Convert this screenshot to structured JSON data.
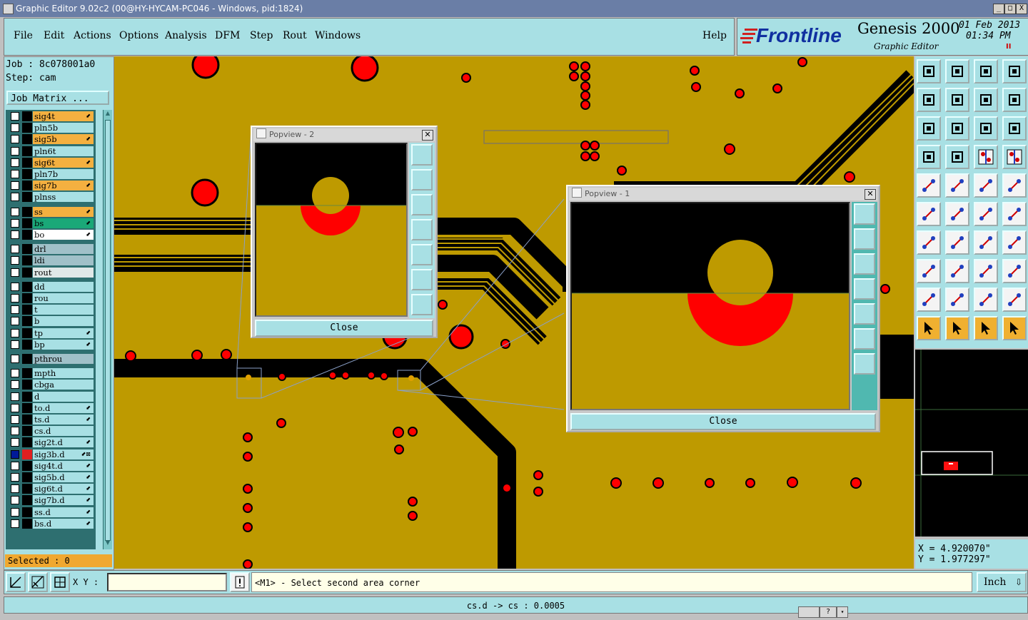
{
  "window": {
    "title": "Graphic Editor 9.02c2 (00@HY-HYCAM-PC046 - Windows, pid:1824)",
    "minimize": "_",
    "maximize": "□",
    "close": "X"
  },
  "menu": [
    "File",
    "Edit",
    "Actions",
    "Options",
    "Analysis",
    "DFM",
    "Step",
    "Rout",
    "Windows"
  ],
  "help": "Help",
  "brand": {
    "logo": "Frontline",
    "product": "Genesis 2000",
    "subtitle": "Graphic Editor",
    "date": "01 Feb 2013",
    "time": "01:34 PM",
    "pause": "II"
  },
  "job": {
    "job_label": "Job : 8c078001a0",
    "step_label": "Step: cam",
    "matrix_button": "Job Matrix ..."
  },
  "layers": [
    {
      "name": "sig4t",
      "color": "#f4b040",
      "arrow": "⬋",
      "sel": false
    },
    {
      "name": "pln5b",
      "color": "#a8e0e4",
      "arrow": "",
      "sel": false
    },
    {
      "name": "sig5b",
      "color": "#f4b040",
      "arrow": "⬋",
      "sel": false
    },
    {
      "name": "pln6t",
      "color": "#a8e0e4",
      "arrow": "",
      "sel": false
    },
    {
      "name": "sig6t",
      "color": "#f4b040",
      "arrow": "⬋",
      "sel": false
    },
    {
      "name": "pln7b",
      "color": "#a8e0e4",
      "arrow": "",
      "sel": false
    },
    {
      "name": "sig7b",
      "color": "#f4b040",
      "arrow": "⬋",
      "sel": false
    },
    {
      "name": "plnss",
      "color": "#a8e0e4",
      "arrow": "",
      "sel": false
    },
    {
      "name": "ss",
      "color": "#f4b040",
      "arrow": "⬋",
      "sel": false
    },
    {
      "name": "bs",
      "color": "#1aa878",
      "arrow": "⬋",
      "sel": false
    },
    {
      "name": "bo",
      "color": "#ffffff",
      "arrow": "⬋",
      "sel": false
    },
    {
      "name": "drl",
      "color": "#a0c0c8",
      "arrow": "",
      "sel": false
    },
    {
      "name": "ldi",
      "color": "#a0c0c8",
      "arrow": "",
      "sel": false
    },
    {
      "name": "rout",
      "color": "#e0e8e8",
      "arrow": "",
      "sel": false
    },
    {
      "name": "dd",
      "color": "#a8e0e4",
      "arrow": "",
      "sel": false
    },
    {
      "name": "rou",
      "color": "#a8e0e4",
      "arrow": "",
      "sel": false
    },
    {
      "name": "t",
      "color": "#a8e0e4",
      "arrow": "",
      "sel": false
    },
    {
      "name": "b",
      "color": "#a8e0e4",
      "arrow": "",
      "sel": false
    },
    {
      "name": "tp",
      "color": "#a8e0e4",
      "arrow": "⬋",
      "sel": false
    },
    {
      "name": "bp",
      "color": "#a8e0e4",
      "arrow": "⬋",
      "sel": false
    },
    {
      "name": "pthrou",
      "color": "#a0c0c8",
      "arrow": "",
      "sel": false
    },
    {
      "name": "mpth",
      "color": "#a8e0e4",
      "arrow": "",
      "sel": false
    },
    {
      "name": "cbga",
      "color": "#a8e0e4",
      "arrow": "",
      "sel": false
    },
    {
      "name": "d",
      "color": "#a8e0e4",
      "arrow": "",
      "sel": false
    },
    {
      "name": "to.d",
      "color": "#a8e0e4",
      "arrow": "⬋",
      "sel": false
    },
    {
      "name": "ts.d",
      "color": "#a8e0e4",
      "arrow": "⬋",
      "sel": false
    },
    {
      "name": "cs.d",
      "color": "#a8e0e4",
      "arrow": "",
      "sel": false
    },
    {
      "name": "sig2t.d",
      "color": "#a8e0e4",
      "arrow": "⬋",
      "sel": false
    },
    {
      "name": "sig3b.d",
      "color": "#a8e0e4",
      "arrow": "⬋⊠",
      "sel": true
    },
    {
      "name": "sig4t.d",
      "color": "#a8e0e4",
      "arrow": "⬋",
      "sel": false
    },
    {
      "name": "sig5b.d",
      "color": "#a8e0e4",
      "arrow": "⬋",
      "sel": false
    },
    {
      "name": "sig6t.d",
      "color": "#a8e0e4",
      "arrow": "⬋",
      "sel": false
    },
    {
      "name": "sig7b.d",
      "color": "#a8e0e4",
      "arrow": "⬋",
      "sel": false
    },
    {
      "name": "ss.d",
      "color": "#a8e0e4",
      "arrow": "⬋",
      "sel": false
    },
    {
      "name": "bs.d",
      "color": "#a8e0e4",
      "arrow": "⬋",
      "sel": false
    }
  ],
  "selected": "Selected : 0",
  "popview2": {
    "title": "Popview - 2",
    "close_label": "Close"
  },
  "popview1": {
    "title": "Popview - 1",
    "close_label": "Close"
  },
  "coords": {
    "x": "X = 4.920070\"",
    "y": "Y = 1.977297\""
  },
  "bottom": {
    "xy_label": "X Y :",
    "xy_value": "",
    "prompt": "<M1> - Select second area corner",
    "unit": "Inch",
    "unit_arrow": "⇩"
  },
  "status": "cs.d -> cs : 0.0005",
  "colors": {
    "copper": "#be9a00",
    "trace_black": "#000000",
    "pad_red": "#ff0000",
    "panel_cyan": "#a8e0e4",
    "title_blue": "#6a7ea6"
  }
}
